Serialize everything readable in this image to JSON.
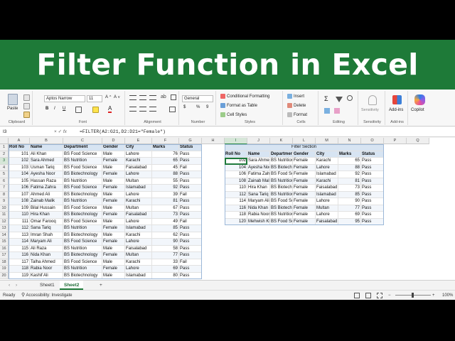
{
  "banner": {
    "title": "Filter Function in Excel"
  },
  "ribbon": {
    "clipboard": {
      "paste": "Paste",
      "label": "Clipboard"
    },
    "font": {
      "name": "Aptos Narrow",
      "size": "11",
      "bold": "B",
      "italic": "I",
      "underline": "U",
      "label": "Font"
    },
    "alignment": {
      "label": "Alignment"
    },
    "number": {
      "format": "General",
      "percent": "%",
      "comma": "9",
      "currency": "$",
      "label": "Number"
    },
    "styles": {
      "conditional": "Conditional Formatting",
      "table": "Format as Table",
      "cell": "Cell Styles",
      "label": "Styles"
    },
    "cells": {
      "insert": "Insert",
      "delete": "Delete",
      "format": "Format",
      "label": "Cells"
    },
    "editing": {
      "sigma": "Σ",
      "label": "Editing"
    },
    "sensitivity": {
      "name": "Sensitivity",
      "label": "Sensitivity"
    },
    "addins": {
      "name": "Add-ins",
      "label": "Add-ins"
    },
    "copilot": {
      "name": "Copilot"
    }
  },
  "formula_bar": {
    "name_box": "I3",
    "fx": "fx",
    "formula": "=FILTER(A2:G21,D2:D21=\"Female\")"
  },
  "columns": [
    "A",
    "B",
    "C",
    "D",
    "E",
    "F",
    "G",
    "H",
    "I",
    "J",
    "K",
    "L",
    "M",
    "N",
    "O",
    "P",
    "Q"
  ],
  "main_headers": [
    "Roll No",
    "Name",
    "Department",
    "Gender",
    "City",
    "Marks",
    "Status"
  ],
  "main_rows": [
    [
      "101",
      "Ali Khan",
      "BS Food Science",
      "Male",
      "Lahore",
      "76",
      "Pass"
    ],
    [
      "102",
      "Sara Ahmed",
      "BS Nutrition",
      "Female",
      "Karachi",
      "65",
      "Pass"
    ],
    [
      "103",
      "Usman Tariq",
      "BS Food Science",
      "Male",
      "Faisalabad",
      "45",
      "Fail"
    ],
    [
      "104",
      "Ayesha Noor",
      "BS Biotechnology",
      "Female",
      "Lahore",
      "88",
      "Pass"
    ],
    [
      "105",
      "Hassan Raza",
      "BS Nutrition",
      "Male",
      "Multan",
      "55",
      "Pass"
    ],
    [
      "106",
      "Fatima Zahra",
      "BS Food Science",
      "Female",
      "Islamabad",
      "92",
      "Pass"
    ],
    [
      "107",
      "Ahmed Ali",
      "BS Biotechnology",
      "Male",
      "Lahore",
      "39",
      "Fail"
    ],
    [
      "108",
      "Zainab Malik",
      "BS Nutrition",
      "Female",
      "Karachi",
      "81",
      "Pass"
    ],
    [
      "109",
      "Bilal Hussain",
      "BS Food Science",
      "Male",
      "Multan",
      "67",
      "Pass"
    ],
    [
      "110",
      "Hira Khan",
      "BS Biotechnology",
      "Female",
      "Faisalabad",
      "73",
      "Pass"
    ],
    [
      "111",
      "Omar Farooq",
      "BS Food Science",
      "Male",
      "Lahore",
      "49",
      "Fail"
    ],
    [
      "112",
      "Sana Tariq",
      "BS Nutrition",
      "Female",
      "Islamabad",
      "85",
      "Pass"
    ],
    [
      "113",
      "Imran Shah",
      "BS Biotechnology",
      "Male",
      "Karachi",
      "62",
      "Pass"
    ],
    [
      "114",
      "Maryam Ali",
      "BS Food Science",
      "Female",
      "Lahore",
      "90",
      "Pass"
    ],
    [
      "115",
      "Ali Raza",
      "BS Nutrition",
      "Male",
      "Faisalabad",
      "58",
      "Pass"
    ],
    [
      "116",
      "Nida Khan",
      "BS Biotechnology",
      "Female",
      "Multan",
      "77",
      "Pass"
    ],
    [
      "117",
      "Talha Ahmed",
      "BS Food Science",
      "Male",
      "Karachi",
      "33",
      "Fail"
    ],
    [
      "118",
      "Rabia Noor",
      "BS Nutrition",
      "Female",
      "Lahore",
      "69",
      "Pass"
    ],
    [
      "119",
      "Kashif Ali",
      "BS Biotechnology",
      "Male",
      "Islamabad",
      "80",
      "Pass"
    ]
  ],
  "filter_title": "Filter Section",
  "filter_headers": [
    "Roll No",
    "Name",
    "Department",
    "Gender",
    "City",
    "Marks",
    "Status"
  ],
  "filter_rows": [
    [
      "102",
      "Sara Ahmed",
      "BS Nutrition",
      "Female",
      "Karachi",
      "65",
      "Pass"
    ],
    [
      "104",
      "Ayesha Noor",
      "BS Biotechnology",
      "Female",
      "Lahore",
      "88",
      "Pass"
    ],
    [
      "106",
      "Fatima Zahra",
      "BS Food Science",
      "Female",
      "Islamabad",
      "92",
      "Pass"
    ],
    [
      "108",
      "Zainab Malik",
      "BS Nutrition",
      "Female",
      "Karachi",
      "81",
      "Pass"
    ],
    [
      "110",
      "Hira Khan",
      "BS Biotechnology",
      "Female",
      "Faisalabad",
      "73",
      "Pass"
    ],
    [
      "112",
      "Sana Tariq",
      "BS Nutrition",
      "Female",
      "Islamabad",
      "85",
      "Pass"
    ],
    [
      "114",
      "Maryam Ali",
      "BS Food Science",
      "Female",
      "Lahore",
      "90",
      "Pass"
    ],
    [
      "116",
      "Nida Khan",
      "BS Biotechnology",
      "Female",
      "Multan",
      "77",
      "Pass"
    ],
    [
      "118",
      "Rabia Noor",
      "BS Nutrition",
      "Female",
      "Lahore",
      "69",
      "Pass"
    ],
    [
      "120",
      "Mehwish Khan",
      "BS Food Science",
      "Female",
      "Faisalabad",
      "95",
      "Pass"
    ]
  ],
  "sheets": [
    "Sheet1",
    "Sheet2"
  ],
  "add_sheet": "+",
  "status": {
    "ready": "Ready",
    "accessibility": "Accessibility: Investigate",
    "zoom": "100%"
  },
  "colors": {
    "banner": "#1e7a38",
    "header_fill": "#d7e4f2",
    "selection": "#1f7a3c"
  }
}
